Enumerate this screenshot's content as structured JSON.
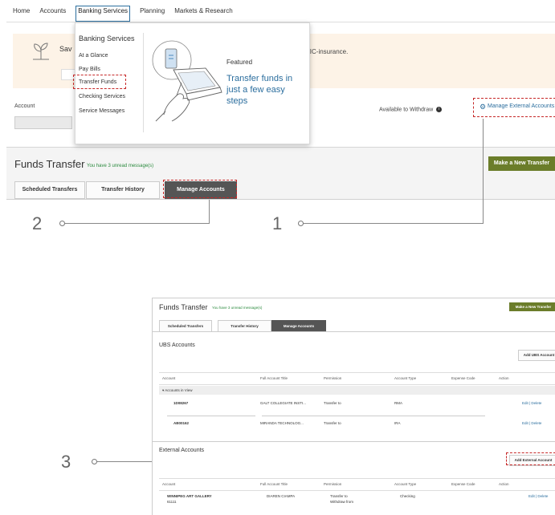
{
  "nav": {
    "home": "Home",
    "accounts": "Accounts",
    "banking_services": "Banking Services",
    "planning": "Planning",
    "markets": "Markets & Research"
  },
  "banner": {
    "save_text": "Sav",
    "insurance_text": "DIC-insurance."
  },
  "dropdown": {
    "title": "Banking Services",
    "items": [
      "At a Glance",
      "Pay Bills",
      "Transfer Funds",
      "Checking Services",
      "Service Messages"
    ],
    "featured_label": "Featured",
    "featured_headline": "Transfer funds in just a few easy steps"
  },
  "account_section": {
    "account_label": "Account",
    "available_label": "Available to Withdraw",
    "manage_external": "Manage External Accounts"
  },
  "funds_transfer": {
    "title": "Funds Transfer",
    "unread": "You have 3 unread message(s)",
    "new_transfer_button": "Make a New Transfer",
    "tabs": [
      "Scheduled Transfers",
      "Transfer History",
      "Manage Accounts"
    ],
    "selected_tab": "Manage Accounts"
  },
  "callouts": [
    "1",
    "2",
    "3"
  ],
  "ubs_accounts": {
    "heading": "UBS Accounts",
    "add_button": "Add UBS Account",
    "columns": [
      "Account",
      "Full Account Title",
      "Permission",
      "Account Type",
      "Expense Code",
      "Action"
    ],
    "group_label": "Accounts in View",
    "rows": [
      {
        "account": "1D08267",
        "title": "GALT COLLEGIATE INSTI...",
        "permission": "Transfer to",
        "type": "RMA",
        "expense": "",
        "action": "Edit | Delete"
      },
      {
        "account": "AB00162",
        "title": "MIRANDA TECHNOLOG...",
        "permission": "Transfer to",
        "type": "IRA",
        "expense": "",
        "action": "Edit | Delete"
      }
    ]
  },
  "external_accounts": {
    "heading": "External Accounts",
    "add_button": "Add External Account",
    "columns": [
      "Account",
      "Full Account Title",
      "Permission",
      "Account Type",
      "Expense Code",
      "Action"
    ],
    "rows": [
      {
        "account": "WINNIPEG ART GALLERY",
        "account_sub": "61111",
        "title": "DIAREN CIAMPA",
        "permission": "Transfer to",
        "permission_sub": "Withdraw from",
        "type": "Checking",
        "expense": "",
        "action": "Edit | Delete"
      }
    ]
  },
  "colors": {
    "accent_blue": "#2b6e9e",
    "highlight_red": "#c62828",
    "button_olive": "#6b7d2a",
    "banner_bg": "#fdf3e7",
    "unread_green": "#2b8a3e"
  }
}
